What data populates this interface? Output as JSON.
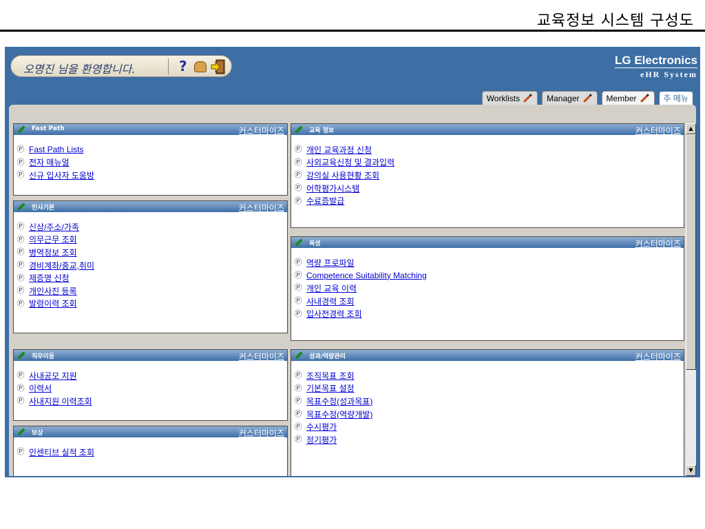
{
  "slide": {
    "title": "교육정보 시스템 구성도"
  },
  "header": {
    "greeting": "오명진 님을 환영합니다.",
    "brand_name": "LG Electronics",
    "brand_sub": "eHR System",
    "tabs": [
      {
        "label": "Worklists",
        "active": false
      },
      {
        "label": "Manager",
        "active": false
      },
      {
        "label": "Member",
        "active": true
      },
      {
        "label": "주 메뉴",
        "active": false
      }
    ]
  },
  "portlets": {
    "fast_path": {
      "title": "Fast Path",
      "customize": "커스터마이즈",
      "items": [
        "Fast Path Lists",
        "전자 매뉴얼",
        "신규 입사자 도움방"
      ]
    },
    "personal": {
      "title": "인사기본",
      "customize": "커스터마이즈",
      "items": [
        "신상/주소/가족",
        "의무근무 조회",
        "병역정보 조회",
        "경비계좌/종교,취미",
        "제증명 신청",
        "개인사진 등록",
        "발령이력 조회"
      ]
    },
    "transfer": {
      "title": "직무이동",
      "customize": "커스터마이즈",
      "items": [
        "사내공모 지원",
        "이력서",
        "사내지원 이력조회"
      ]
    },
    "reward": {
      "title": "보상",
      "customize": "커스터마이즈",
      "items": [
        "인센티브 실적 조회"
      ]
    },
    "education": {
      "title": "교육 정보",
      "customize": "커스터마이즈",
      "items": [
        "개인 교육과정 신청",
        "사외교육신청 및 결과입력",
        "강의실 사용현황 조회",
        "어학평가시스템",
        "수료증발급"
      ]
    },
    "development": {
      "title": "육성",
      "customize": "커스터마이즈",
      "items": [
        "역량 프로파일",
        "Competence Suitability Matching",
        "개인 교육 이력",
        "사내경력 조회",
        "입사전경력 조회"
      ]
    },
    "performance": {
      "title": "성과/역량관리",
      "customize": "커스터마이즈",
      "items": [
        "조직목표 조회",
        "기본목표 설정",
        "목표수정(성과목표)",
        "목표수정(역량개발)",
        "수시평가",
        "정기평가"
      ]
    }
  }
}
